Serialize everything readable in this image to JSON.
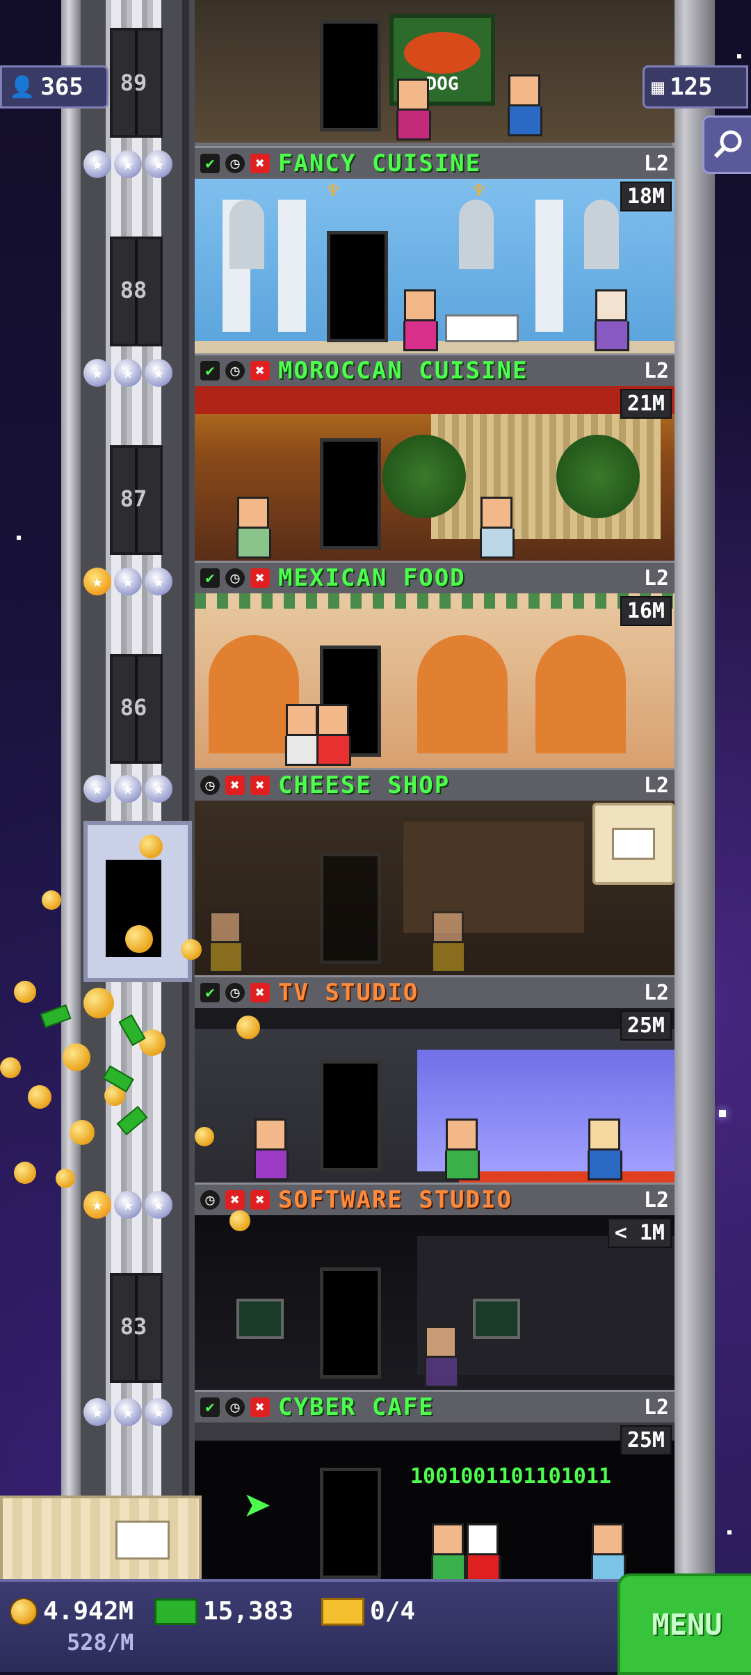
{
  "hud": {
    "population": "365",
    "floors_count": "125"
  },
  "floor_numbers": [
    "89",
    "88",
    "87",
    "86",
    "83"
  ],
  "floors": [
    {
      "name": "FANCY CUISINE",
      "level": "L2",
      "badge": "18M",
      "style": "green"
    },
    {
      "name": "MOROCCAN CUISINE",
      "level": "L2",
      "badge": "21M",
      "style": "green"
    },
    {
      "name": "MEXICAN FOOD",
      "level": "L2",
      "badge": "16M",
      "style": "green"
    },
    {
      "name": "CHEESE SHOP",
      "level": "L2",
      "badge": "",
      "style": "green"
    },
    {
      "name": "TV STUDIO",
      "level": "L2",
      "badge": "25M",
      "style": "orange"
    },
    {
      "name": "SOFTWARE STUDIO",
      "level": "L2",
      "badge": "< 1M",
      "style": "orange"
    },
    {
      "name": "CYBER CAFE",
      "level": "L2",
      "badge": "25M",
      "style": "green"
    }
  ],
  "top_floor_sign": "DOG",
  "cyber_binary": "1001001101101011",
  "bottom": {
    "coins": "4.942M",
    "coins_rate": "528/M",
    "bux": "15,383",
    "tickets": "0/4",
    "menu_label": "MENU"
  },
  "colors": {
    "name_green": "#4cff4c",
    "name_orange": "#ff8a3a",
    "menu_green": "#37c43a"
  }
}
